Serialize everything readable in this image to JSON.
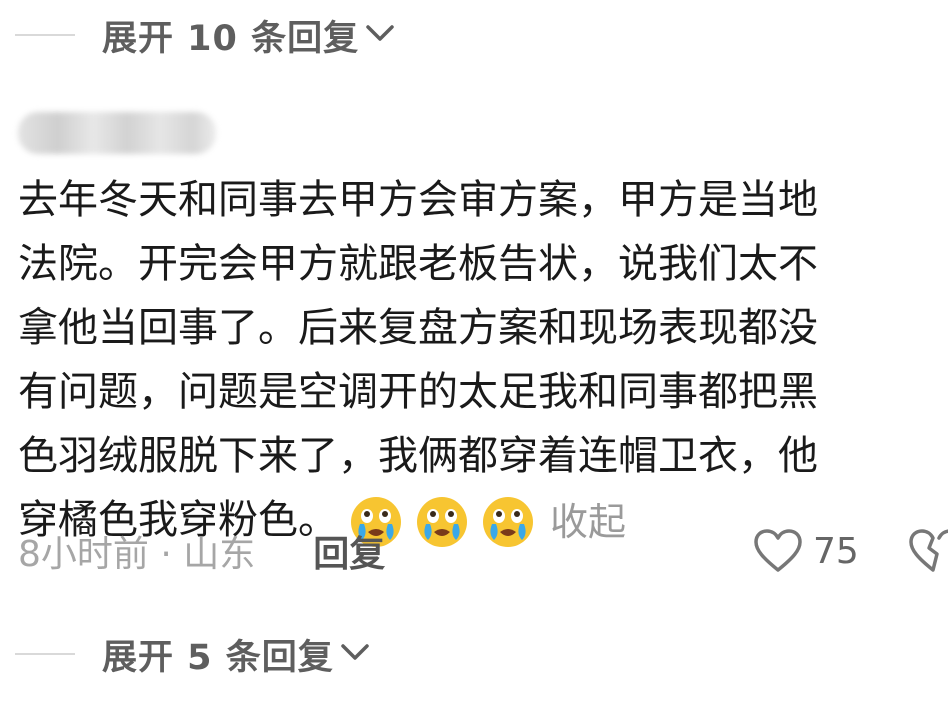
{
  "replies_top": {
    "label": "展开 10 条回复"
  },
  "comment": {
    "lines": [
      "去年冬天和同事去甲方会审方案，甲方是当地",
      "法院。开完会甲方就跟老板告状，说我们太不",
      "拿他当回事了。后来复盘方案和现场表现都没",
      "有问题，问题是空调开的太足我和同事都把黑",
      "色羽绒服脱下来了，我俩都穿着连帽卫衣，他",
      "穿橘色我穿粉色。"
    ],
    "emojis": [
      "crying-laughing-emoji",
      "crying-laughing-emoji",
      "crying-laughing-emoji"
    ],
    "collapse_label": "收起"
  },
  "meta": {
    "time_location": "8小时前 · 山东",
    "reply_label": "回复",
    "like_count": "75"
  },
  "replies_bottom": {
    "label": "展开 5 条回复"
  },
  "colors": {
    "text": "#1a1a1a",
    "muted": "#a6a6a6",
    "expand": "#5e5e5e",
    "emoji_yellow": "#f7c531",
    "emoji_tears": "#3aa8e8"
  }
}
